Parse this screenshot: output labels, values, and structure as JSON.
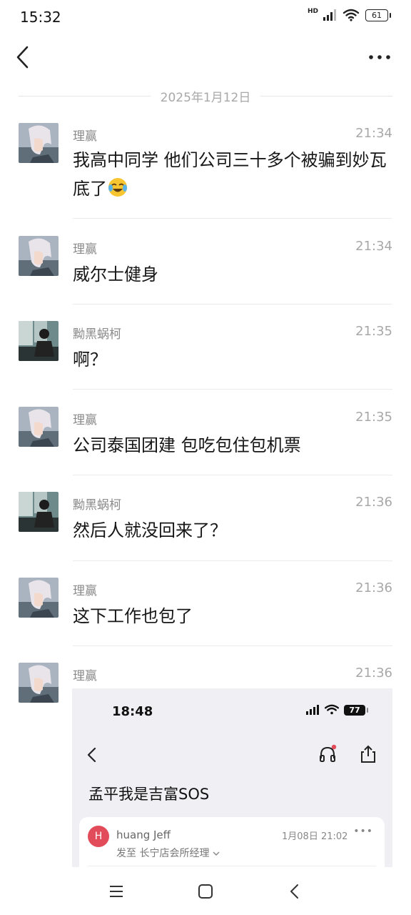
{
  "status_bar": {
    "time": "15:32",
    "network_label": "HD",
    "battery": "61"
  },
  "nav": {
    "back_icon": "chevron-left-icon",
    "more_icon": "more-horizontal-icon"
  },
  "date_separator": "2025年1月12日",
  "messages": [
    {
      "sender": "理赢",
      "time": "21:34",
      "text": "我高中同学 他们公司三十多个被骗到妙瓦底了",
      "emoji": "crying-laughing-emoji"
    },
    {
      "sender": "理赢",
      "time": "21:34",
      "text": "威尔士健身"
    },
    {
      "sender": "黝黑蜗柯",
      "time": "21:35",
      "text": "啊？"
    },
    {
      "sender": "理赢",
      "time": "21:35",
      "text": "公司泰国团建 包吃包住包机票"
    },
    {
      "sender": "黝黑蜗柯",
      "time": "21:36",
      "text": "然后人就没回来了？"
    },
    {
      "sender": "理赢",
      "time": "21:36",
      "text": "这下工作也包了"
    },
    {
      "sender": "理赢",
      "time": "21:36",
      "image": "embedded-screenshot"
    }
  ],
  "embedded_screenshot": {
    "time": "18:48",
    "battery": "77",
    "title": "孟平我是吉富SOS",
    "sender_initial": "H",
    "sender": "huang Jeff",
    "date": "1月08日 21:02",
    "to": "发至 长宁店会所经理"
  },
  "colors": {
    "accent_red": "#e24b5a",
    "muted_text": "#a8a8a8"
  }
}
